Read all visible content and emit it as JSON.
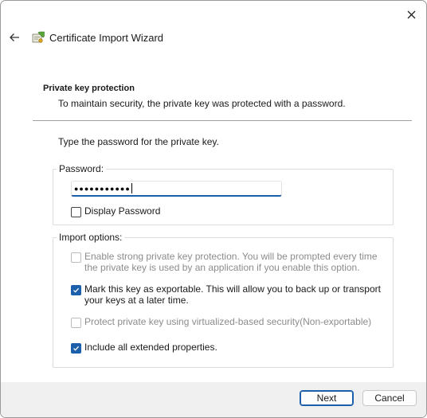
{
  "window": {
    "title": "Certificate Import Wizard",
    "icons": {
      "close": "close-icon",
      "back": "back-arrow-icon",
      "app": "certificate-wizard-icon"
    }
  },
  "header": {
    "heading": "Private key protection",
    "description": "To maintain security, the private key was protected with a password."
  },
  "prompt": "Type the password for the private key.",
  "password_group": {
    "legend": "Password:",
    "value_mask": "●●●●●●●●●●●",
    "display_password": {
      "label": "Display Password",
      "checked": false
    }
  },
  "import_options": {
    "legend": "Import options:",
    "items": [
      {
        "label": "Enable strong private key protection. You will be prompted every time the private key is used by an application if you enable this option.",
        "checked": false,
        "enabled": false
      },
      {
        "label": "Mark this key as exportable. This will allow you to back up or transport your keys at a later time.",
        "checked": true,
        "enabled": true
      },
      {
        "label": "Protect private key using virtualized-based security(Non-exportable)",
        "checked": false,
        "enabled": false
      },
      {
        "label": "Include all extended properties.",
        "checked": true,
        "enabled": true
      }
    ]
  },
  "buttons": {
    "next": "Next",
    "cancel": "Cancel"
  },
  "colors": {
    "accent": "#1b5ea9",
    "footer": "#f0f0f0",
    "disabled_text": "#8c8c8c"
  }
}
